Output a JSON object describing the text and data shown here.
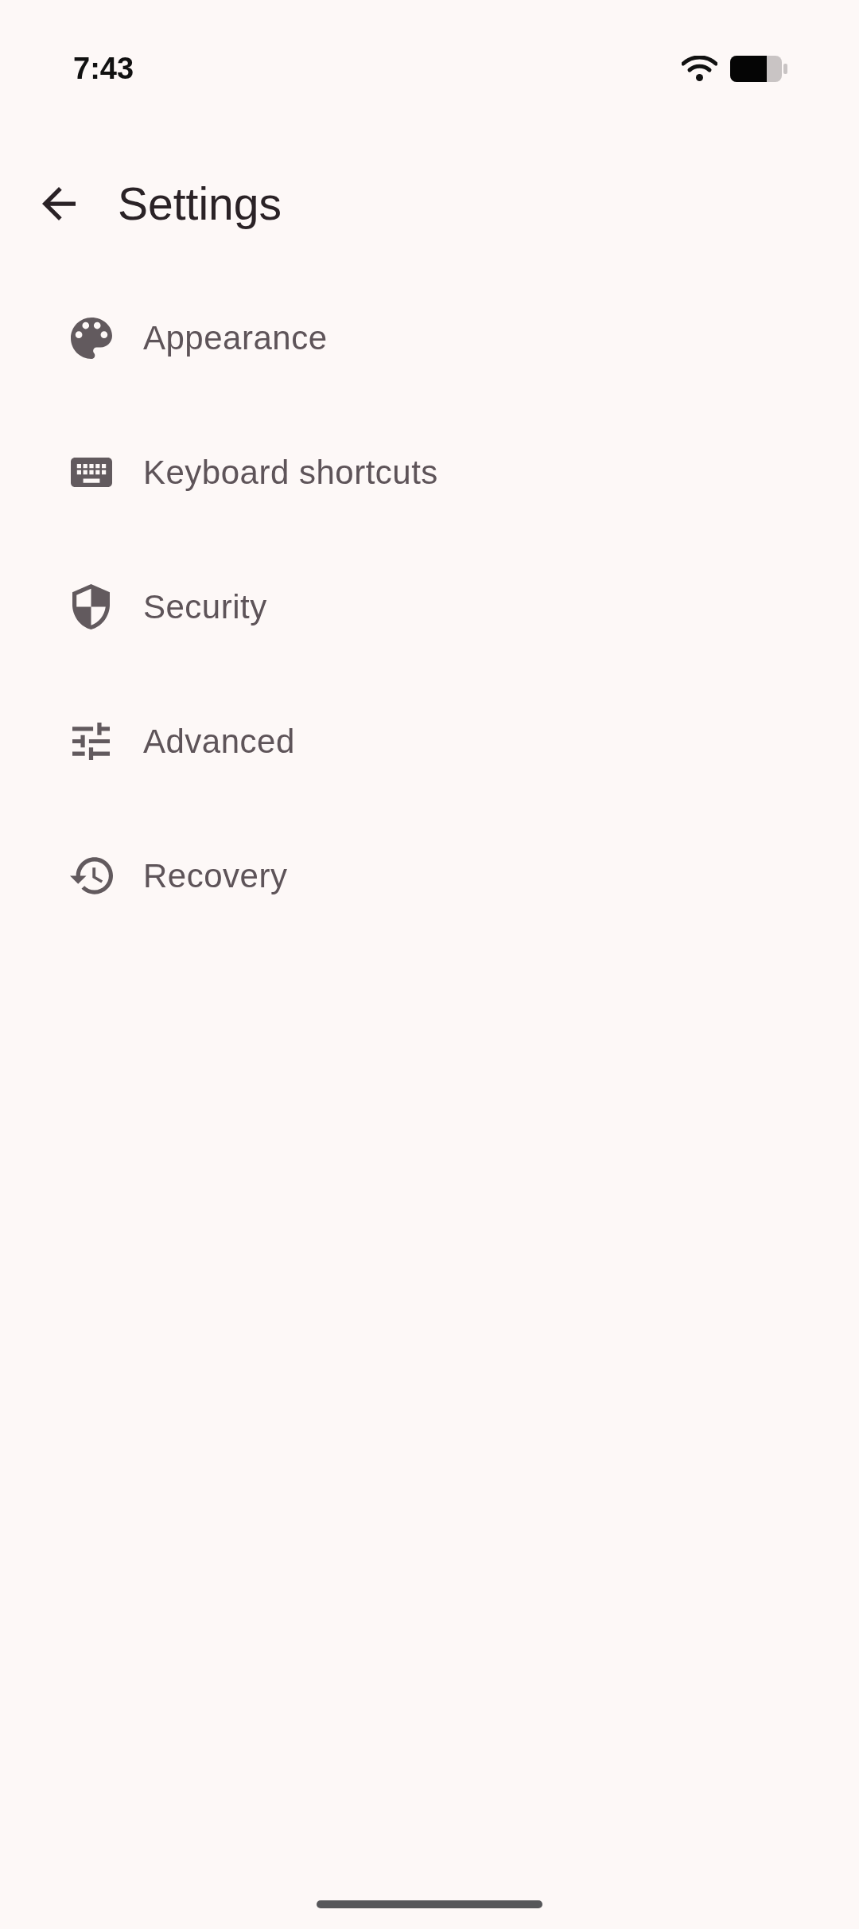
{
  "status_bar": {
    "time": "7:43"
  },
  "app_bar": {
    "title": "Settings"
  },
  "items": [
    {
      "label": "Appearance"
    },
    {
      "label": "Keyboard shortcuts"
    },
    {
      "label": "Security"
    },
    {
      "label": "Advanced"
    },
    {
      "label": "Recovery"
    }
  ]
}
